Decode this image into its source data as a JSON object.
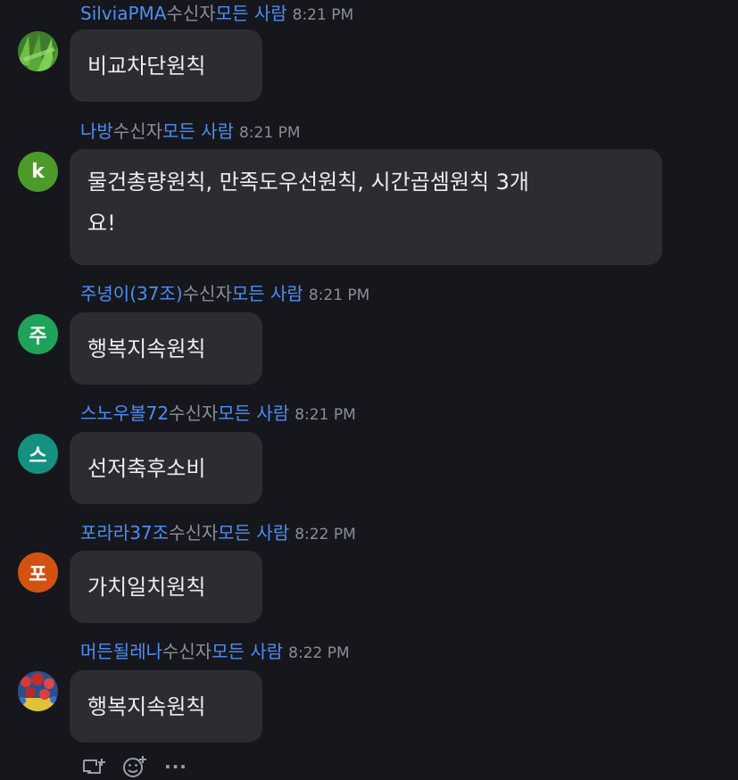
{
  "messages": [
    {
      "sender": "SilviaPMA",
      "recipient_label": "수신자",
      "audience": "모든 사람",
      "time": "8:21 PM",
      "text": "비교차단원칙",
      "avatar": {
        "type": "image",
        "icon": "grass-photo-avatar",
        "color": "#4e9a3a"
      }
    },
    {
      "sender": "나방",
      "recipient_label": "수신자",
      "audience": "모든 사람",
      "time": "8:21 PM",
      "text_lines": [
        "물건총량원칙, 만족도우선원칙, 시간곱셈원칙 3개",
        "요!"
      ],
      "avatar": {
        "type": "letter",
        "letter": "k",
        "color": "#4c9a2a"
      }
    },
    {
      "sender": "주녕이(37조)",
      "recipient_label": "수신자",
      "audience": "모든 사람",
      "time": "8:21 PM",
      "text": "행복지속원칙",
      "avatar": {
        "type": "letter",
        "letter": "주",
        "color": "#1fa25a"
      }
    },
    {
      "sender": "스노우볼72",
      "recipient_label": "수신자",
      "audience": "모든 사람",
      "time": "8:21 PM",
      "text": "선저축후소비",
      "avatar": {
        "type": "letter",
        "letter": "스",
        "color": "#15927f"
      }
    },
    {
      "sender": "포라라37조",
      "recipient_label": "수신자",
      "audience": "모든 사람",
      "time": "8:22 PM",
      "text": "가치일치원칙",
      "avatar": {
        "type": "letter",
        "letter": "포",
        "color": "#d4520f"
      }
    },
    {
      "sender": "머든될레나",
      "recipient_label": "수신자",
      "audience": "모든 사람",
      "time": "8:22 PM",
      "text": "행복지속원칙",
      "avatar": {
        "type": "image",
        "icon": "flowers-photo-avatar",
        "color": "#b23a3a"
      }
    }
  ],
  "toolbar": {
    "icons": [
      "reply-thread-icon",
      "add-reaction-icon",
      "more-options-icon"
    ],
    "more_label": "···"
  }
}
